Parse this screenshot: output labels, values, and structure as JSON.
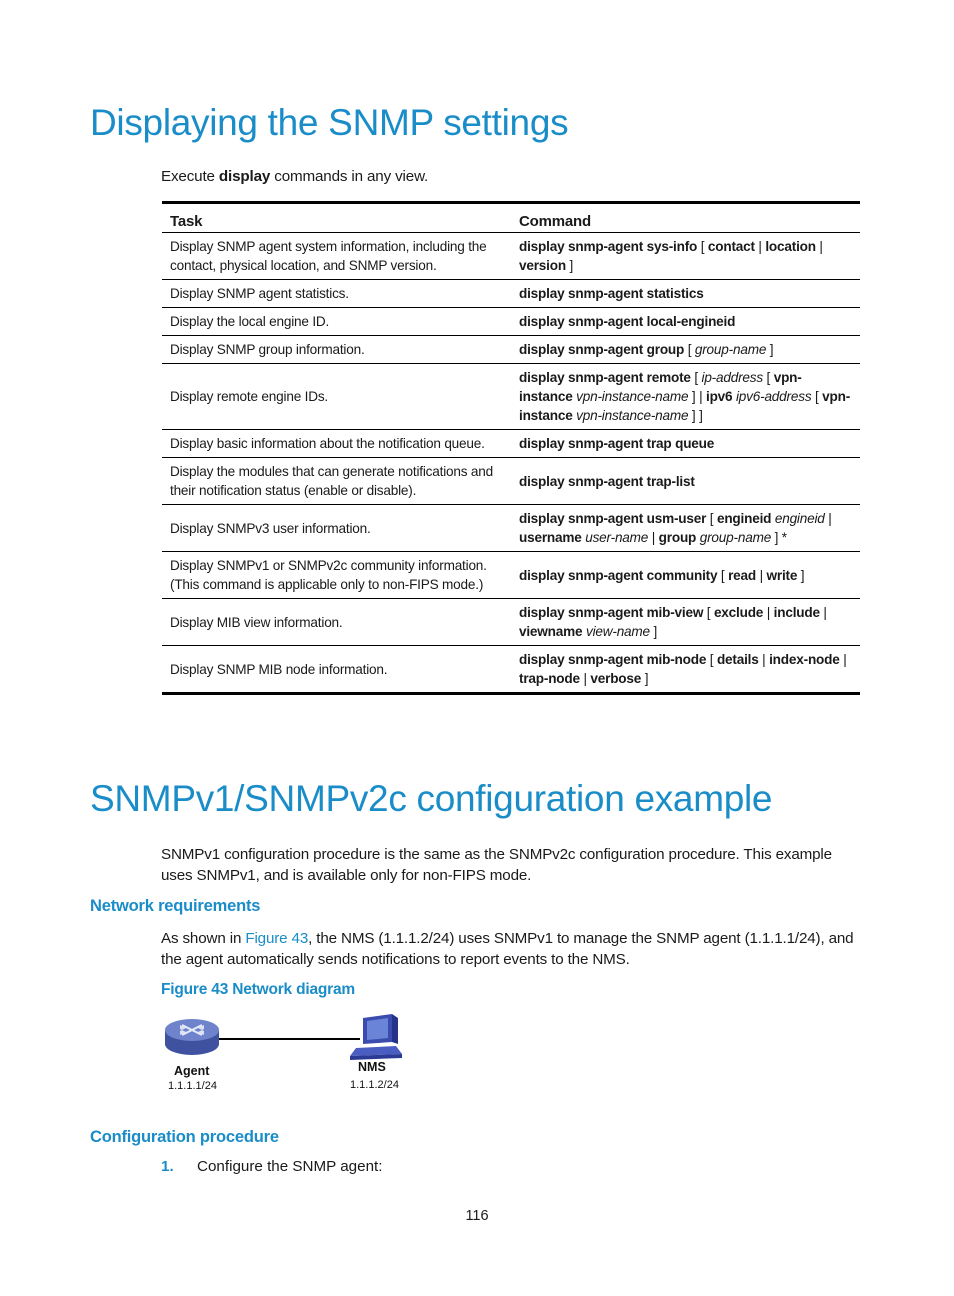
{
  "section1": {
    "title": "Displaying the SNMP settings",
    "intro": {
      "prefix": "Execute ",
      "keyword": "display",
      "suffix": " commands in any view."
    },
    "table": {
      "headers": [
        "Task",
        "Command"
      ],
      "rows": [
        {
          "task": "Display SNMP agent system information, including the contact, physical location, and SNMP version.",
          "command": [
            {
              "t": "display snmp-agent sys-info",
              "s": "kw"
            },
            {
              "t": " [ ",
              "s": ""
            },
            {
              "t": "contact",
              "s": "kw"
            },
            {
              "t": " | ",
              "s": ""
            },
            {
              "t": "location",
              "s": "kw"
            },
            {
              "t": " | ",
              "s": ""
            },
            {
              "t": "version",
              "s": "kw"
            },
            {
              "t": " ]",
              "s": ""
            }
          ]
        },
        {
          "task": "Display SNMP agent statistics.",
          "command": [
            {
              "t": "display snmp-agent statistics",
              "s": "kw"
            }
          ]
        },
        {
          "task": "Display the local engine ID.",
          "command": [
            {
              "t": "display snmp-agent local-engineid",
              "s": "kw"
            }
          ]
        },
        {
          "task": "Display SNMP group information.",
          "command": [
            {
              "t": "display snmp-agent group",
              "s": "kw"
            },
            {
              "t": " [ ",
              "s": ""
            },
            {
              "t": "group-name",
              "s": "arg"
            },
            {
              "t": " ]",
              "s": ""
            }
          ]
        },
        {
          "task": "Display remote engine IDs.",
          "command": [
            {
              "t": "display snmp-agent remote",
              "s": "kw"
            },
            {
              "t": " [ ",
              "s": ""
            },
            {
              "t": "ip-address",
              "s": "arg"
            },
            {
              "t": " [ ",
              "s": ""
            },
            {
              "t": "vpn-instance",
              "s": "kw"
            },
            {
              "t": " ",
              "s": ""
            },
            {
              "t": "vpn-instance-name",
              "s": "arg"
            },
            {
              "t": " ] | ",
              "s": ""
            },
            {
              "t": "ipv6",
              "s": "kw"
            },
            {
              "t": " ",
              "s": ""
            },
            {
              "t": "ipv6-address",
              "s": "arg"
            },
            {
              "t": " [ ",
              "s": ""
            },
            {
              "t": "vpn-instance",
              "s": "kw"
            },
            {
              "t": " ",
              "s": ""
            },
            {
              "t": "vpn-instance-name",
              "s": "arg"
            },
            {
              "t": " ] ]",
              "s": ""
            }
          ]
        },
        {
          "task": "Display basic information about the notification queue.",
          "command": [
            {
              "t": "display snmp-agent trap queue",
              "s": "kw"
            }
          ]
        },
        {
          "task": "Display the modules that can generate notifications and their notification status (enable or disable).",
          "command": [
            {
              "t": "display snmp-agent trap-list",
              "s": "kw"
            }
          ]
        },
        {
          "task": "Display SNMPv3 user information.",
          "command": [
            {
              "t": "display snmp-agent usm-user",
              "s": "kw"
            },
            {
              "t": " [ ",
              "s": ""
            },
            {
              "t": "engineid",
              "s": "kw"
            },
            {
              "t": " ",
              "s": ""
            },
            {
              "t": "engineid",
              "s": "arg"
            },
            {
              "t": " | ",
              "s": ""
            },
            {
              "t": "username",
              "s": "kw"
            },
            {
              "t": " ",
              "s": ""
            },
            {
              "t": "user-name",
              "s": "arg"
            },
            {
              "t": " | ",
              "s": ""
            },
            {
              "t": "group",
              "s": "kw"
            },
            {
              "t": " ",
              "s": ""
            },
            {
              "t": "group-name",
              "s": "arg"
            },
            {
              "t": " ] *",
              "s": ""
            }
          ]
        },
        {
          "task": "Display SNMPv1 or SNMPv2c community information. (This command is applicable only to non-FIPS mode.)",
          "command": [
            {
              "t": "display snmp-agent community",
              "s": "kw"
            },
            {
              "t": " [ ",
              "s": ""
            },
            {
              "t": "read",
              "s": "kw"
            },
            {
              "t": " | ",
              "s": ""
            },
            {
              "t": "write",
              "s": "kw"
            },
            {
              "t": " ]",
              "s": ""
            }
          ]
        },
        {
          "task": "Display MIB view information.",
          "command": [
            {
              "t": "display snmp-agent mib-view",
              "s": "kw"
            },
            {
              "t": " [ ",
              "s": ""
            },
            {
              "t": "exclude",
              "s": "kw"
            },
            {
              "t": " | ",
              "s": ""
            },
            {
              "t": "include",
              "s": "kw"
            },
            {
              "t": " | ",
              "s": ""
            },
            {
              "t": "viewname",
              "s": "kw"
            },
            {
              "t": " ",
              "s": ""
            },
            {
              "t": "view-name",
              "s": "arg"
            },
            {
              "t": " ]",
              "s": ""
            }
          ]
        },
        {
          "task": "Display SNMP MIB node information.",
          "command": [
            {
              "t": "display snmp-agent mib-node",
              "s": "kw"
            },
            {
              "t": " [ ",
              "s": ""
            },
            {
              "t": "details",
              "s": "kw"
            },
            {
              "t": " | ",
              "s": ""
            },
            {
              "t": "index-node",
              "s": "kw"
            },
            {
              "t": " | ",
              "s": ""
            },
            {
              "t": "trap-node",
              "s": "kw"
            },
            {
              "t": " | ",
              "s": ""
            },
            {
              "t": "verbose",
              "s": "kw"
            },
            {
              "t": " ]",
              "s": ""
            }
          ]
        }
      ]
    }
  },
  "section2": {
    "title": "SNMPv1/SNMPv2c configuration example",
    "intro": "SNMPv1 configuration procedure is the same as the SNMPv2c configuration procedure. This example uses SNMPv1, and is available only for non-FIPS mode.",
    "network_requirements": {
      "heading": "Network requirements",
      "text_prefix": "As shown in ",
      "link": "Figure 43",
      "text_suffix": ", the NMS (1.1.1.2/24) uses SNMPv1 to manage the SNMP agent (1.1.1.1/24), and the agent automatically sends notifications to report events to the NMS.",
      "figure_caption": "Figure 43 Network diagram",
      "diagram": {
        "agent_label": "Agent",
        "agent_ip": "1.1.1.1/24",
        "nms_label": "NMS",
        "nms_ip": "1.1.1.2/24",
        "colors": {
          "device": "#5a6fb8",
          "line": "#000000"
        }
      }
    },
    "configuration_procedure": {
      "heading": "Configuration procedure",
      "steps": [
        {
          "number": "1.",
          "text": "Configure the SNMP agent:"
        }
      ]
    }
  },
  "page_number": "116"
}
